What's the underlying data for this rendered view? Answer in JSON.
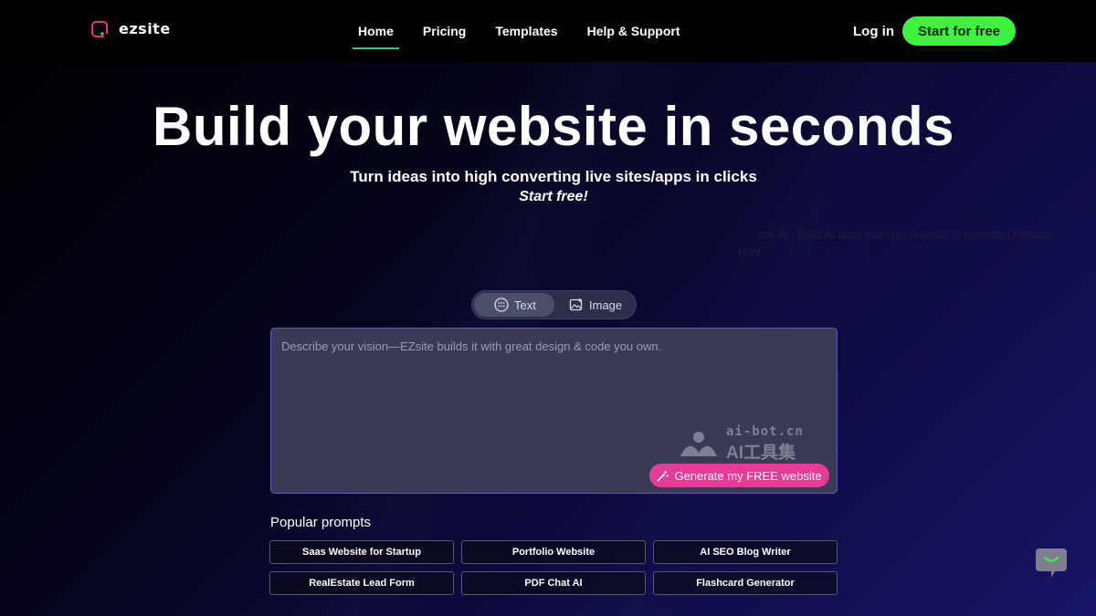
{
  "nav": {
    "logo_text": "ezsite",
    "links": [
      {
        "label": "Home",
        "active": true
      },
      {
        "label": "Pricing"
      },
      {
        "label": "Templates"
      },
      {
        "label": "Help & Support"
      }
    ],
    "login_label": "Log in",
    "cta_label": "Start for free"
  },
  "hero": {
    "title": "Build your website in seconds",
    "subtitle": "Turn ideas into high converting live sites/apps in clicks",
    "tagline": "Start free!"
  },
  "product_hunt_alt": "Ezsite AI - Build AI apps that ship revenue in seconds | Product Hunt",
  "product_hunt_alt_lead": "site AI - Build AI apps that ship revenue in seconds | Product",
  "product_hunt_alt_tail": "Hunt",
  "mode_toggle": {
    "text_label": "Text",
    "image_label": "Image",
    "selected": "Text"
  },
  "prompt": {
    "placeholder": "Describe your vision—EZsite builds it with great design & code you own.",
    "value": "",
    "generate_label": "Generate my FREE website"
  },
  "watermark": {
    "domain": "ai-bot.cn",
    "name": "AI工具集"
  },
  "popular": {
    "heading": "Popular prompts",
    "items": [
      "Saas Website for Startup",
      "Portfolio Website",
      "AI SEO Blog Writer",
      "RealEstate Lead Form",
      "PDF Chat AI",
      "Flashcard Generator"
    ]
  },
  "colors": {
    "accent_green": "#3ff23f",
    "brand_pink": "#e33d97",
    "nav_underline": "#21d07a"
  },
  "icons": [
    "ezsite-logo-icon",
    "text-mode-icon",
    "image-mode-icon",
    "magic-wand-icon",
    "watermark-logo-icon",
    "chat-support-icon"
  ]
}
